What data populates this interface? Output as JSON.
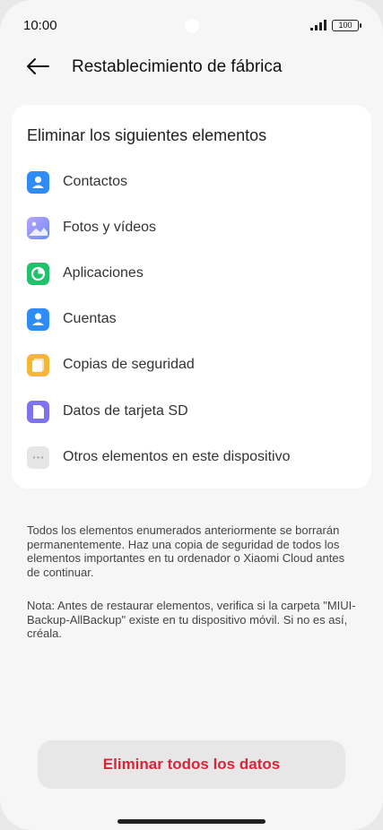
{
  "status_bar": {
    "time": "10:00",
    "battery": "100"
  },
  "header": {
    "title": "Restablecimiento de fábrica"
  },
  "card": {
    "title": "Eliminar los siguientes elementos",
    "items": [
      {
        "label": "Contactos",
        "icon": "contacts-icon",
        "color": "#2f8cf5"
      },
      {
        "label": "Fotos y vídeos",
        "icon": "gallery-icon",
        "color": "#8f7cf4"
      },
      {
        "label": "Aplicaciones",
        "icon": "apps-icon",
        "color": "#1fc26a"
      },
      {
        "label": "Cuentas",
        "icon": "account-icon",
        "color": "#2f8cf5"
      },
      {
        "label": "Copias de seguridad",
        "icon": "backup-icon",
        "color": "#f7b731"
      },
      {
        "label": "Datos de tarjeta SD",
        "icon": "sd-card-icon",
        "color": "#7d73ec"
      },
      {
        "label": "Otros elementos en este dispositivo",
        "icon": "more-icon",
        "color": "#e6e6e6"
      }
    ]
  },
  "notes": {
    "warning": "Todos los elementos enumerados anteriormente se borrarán permanentemente. Haz una copia de seguridad de todos los elementos importantes en tu ordenador o Xiaomi Cloud antes de continuar.",
    "note": "Nota: Antes de restaurar elementos, verifica si la carpeta \"MIUI-Backup-AllBackup\" existe en tu dispositivo móvil. Si no es así, créala."
  },
  "actions": {
    "erase_label": "Eliminar todos los datos"
  },
  "colors": {
    "danger": "#d7253a",
    "background": "#f6f6f6"
  }
}
